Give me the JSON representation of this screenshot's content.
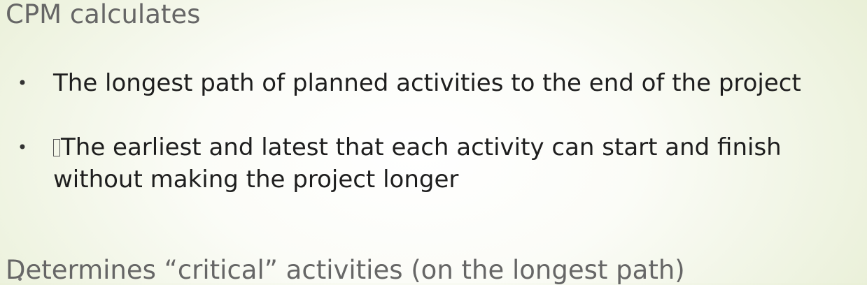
{
  "slide": {
    "heading_top": "CPM calculates",
    "bullets": [
      "The longest path of planned activities to the end of the project",
      "The earliest and latest that each activity can start and finish without making the project longer"
    ],
    "bullet_symbol": "•",
    "bullet_2_leading_glyph": "missing-glyph-box",
    "heading_bottom": "Determines “critical” activities (on the longest path)"
  }
}
